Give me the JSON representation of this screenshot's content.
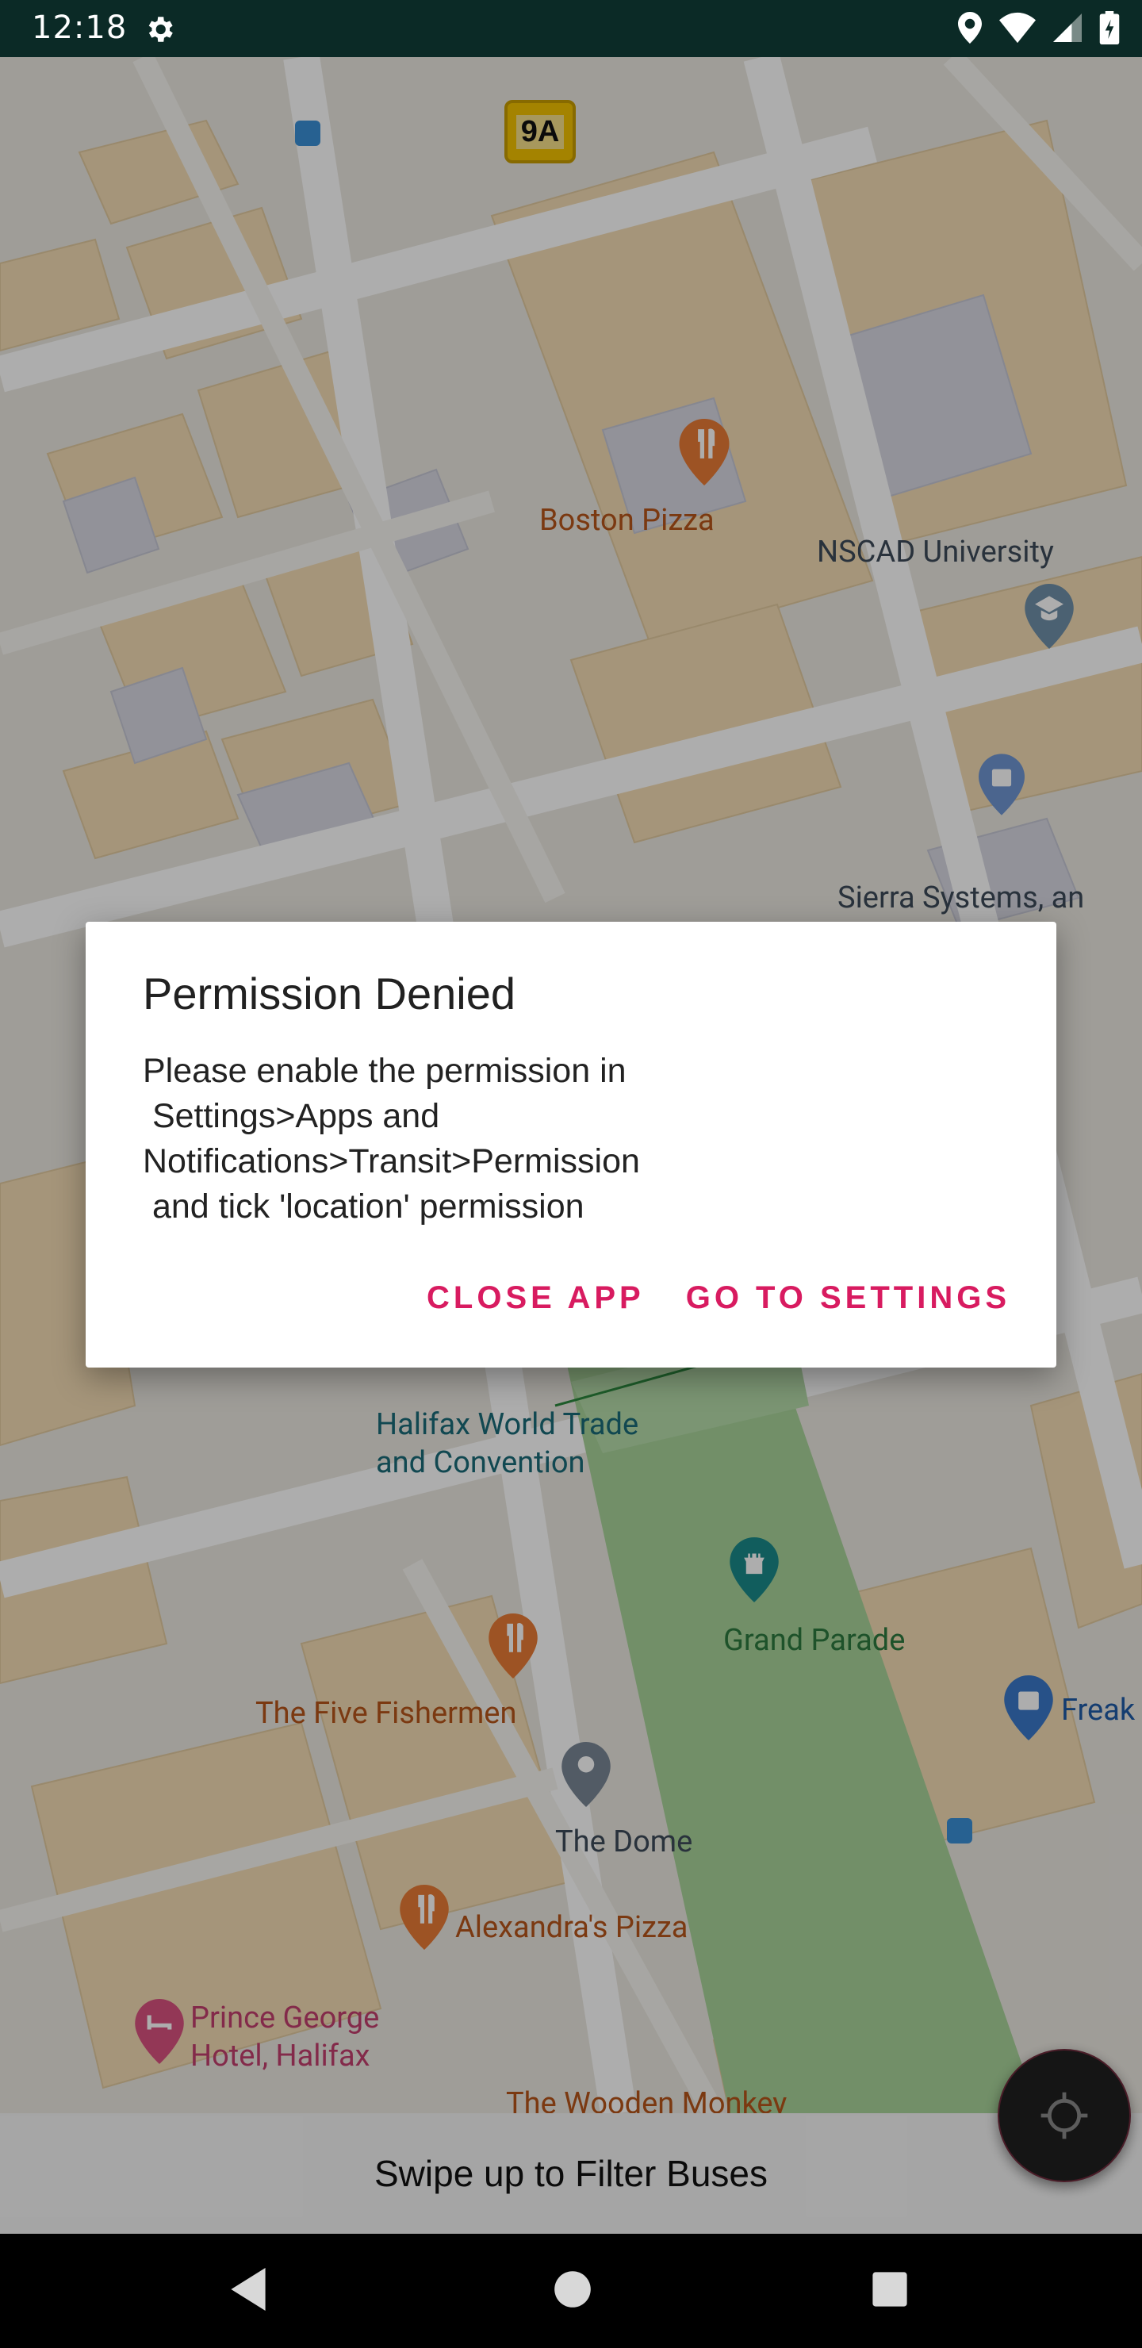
{
  "status_bar": {
    "time": "12:18",
    "icons": [
      "settings-icon",
      "location-icon",
      "wifi-icon",
      "signal-icon",
      "battery-icon"
    ]
  },
  "map": {
    "bus_badge": "9A",
    "labels": {
      "boston_pizza": "Boston Pizza",
      "nscad": "NSCAD University",
      "sierra_systems": "Sierra Systems, an\n               mpany",
      "halifax_world_trade": "Halifax World Trade\nand Convention",
      "grand_parade": "Grand Parade",
      "freak": "Freak",
      "five_fishermen": "The Five Fishermen",
      "the_dome": "The Dome",
      "alexandras_pizza": "Alexandra's Pizza",
      "prince_george": "Prince George\nHotel, Halifax",
      "wooden_monkey": "The Wooden Monkey"
    }
  },
  "dialog": {
    "title": "Permission Denied",
    "message": "Please enable the permission in\n Settings>Apps and\nNotifications>Transit>Permission\n and tick 'location' permission",
    "close_label": "CLOSE APP",
    "settings_label": "GO TO SETTINGS"
  },
  "bottom_sheet": {
    "hint": "Swipe up to Filter Buses"
  },
  "colors": {
    "accent": "#d81b60",
    "status_bar": "#0b2a26",
    "park": "#a8d39a"
  }
}
